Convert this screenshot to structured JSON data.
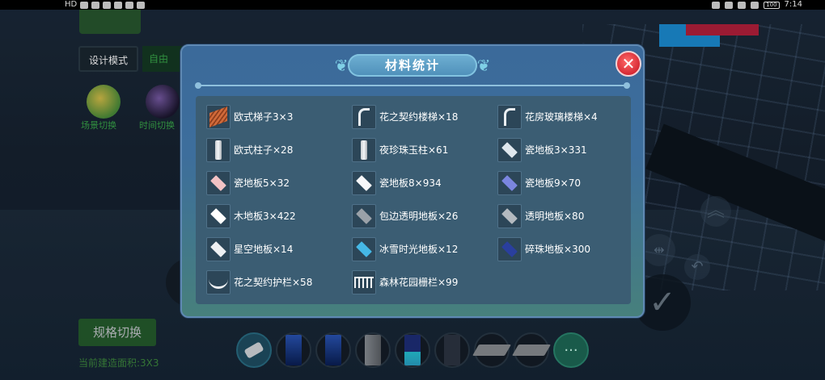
{
  "status_bar": {
    "left_label": "HD",
    "time": "7:14",
    "battery": "100"
  },
  "hud": {
    "design_mode_label": "设计模式",
    "free_mode_label": "自由",
    "circle_label_1": "场景切换",
    "circle_label_2": "时间切换",
    "spec_switch_label": "规格切换",
    "current_size_text": "当前建造面积:3X3"
  },
  "modal": {
    "title": "材料统计",
    "close_symbol": "✕",
    "items": [
      {
        "icon": "stairs-icon",
        "label": "欧式梯子3×3"
      },
      {
        "icon": "spiral-stairs-icon",
        "label": "花之契约楼梯×18"
      },
      {
        "icon": "glass-stairs-icon",
        "label": "花房玻璃楼梯×4"
      },
      {
        "icon": "column-icon",
        "label": "欧式柱子×28"
      },
      {
        "icon": "pearl-pillar-icon",
        "label": "夜珍珠玉柱×61"
      },
      {
        "icon": "tile-icon",
        "label": "瓷地板3×331"
      },
      {
        "icon": "tile-pink-icon",
        "label": "瓷地板5×32"
      },
      {
        "icon": "tile-white-icon",
        "label": "瓷地板8×934"
      },
      {
        "icon": "tile-purple-icon",
        "label": "瓷地板9×70"
      },
      {
        "icon": "wood-floor-icon",
        "label": "木地板3×422"
      },
      {
        "icon": "trim-glass-floor-icon",
        "label": "包边透明地板×26"
      },
      {
        "icon": "glass-floor-icon",
        "label": "透明地板×80"
      },
      {
        "icon": "starry-floor-icon",
        "label": "星空地板×14"
      },
      {
        "icon": "ice-floor-icon",
        "label": "冰雪时光地板×12"
      },
      {
        "icon": "gem-floor-icon",
        "label": "碎珠地板×300"
      },
      {
        "icon": "railing-icon",
        "label": "花之契约护栏×58"
      },
      {
        "icon": "fence-icon",
        "label": "森林花园栅栏×99"
      }
    ]
  },
  "toolbar": {
    "more_label": "···"
  },
  "colors": {
    "modal_top": "#3b6a9a",
    "modal_bottom": "#47807c",
    "panel": "#3b5d73",
    "close_red": "#d62a34",
    "tile_pink": "#f2c2c4",
    "tile_purple": "#7b86e0",
    "tile_ice": "#45b8e6",
    "tile_gem": "#2a3f9e"
  }
}
